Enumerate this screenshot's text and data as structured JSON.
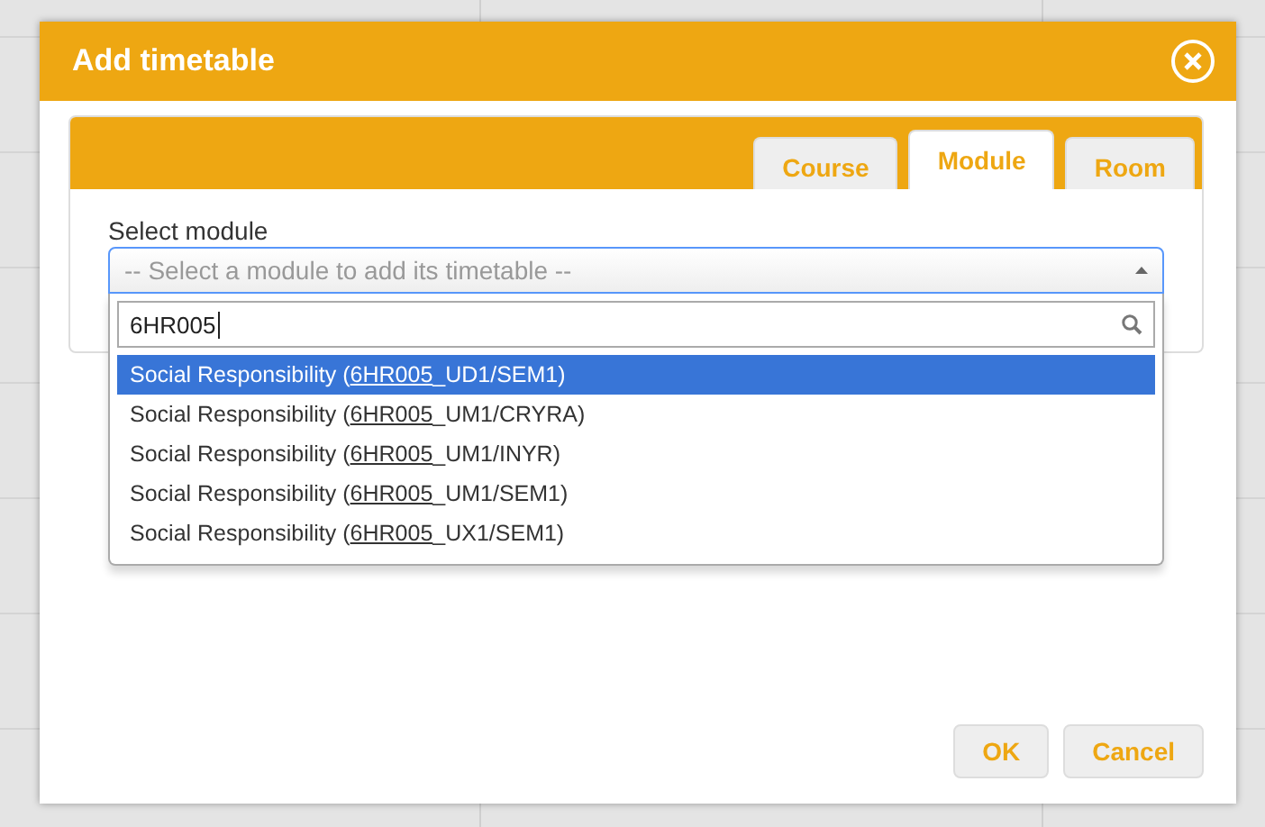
{
  "dialog": {
    "title": "Add timetable"
  },
  "tabs": [
    {
      "label": "Course",
      "selected": false
    },
    {
      "label": "Module",
      "selected": true
    },
    {
      "label": "Room",
      "selected": false
    }
  ],
  "select": {
    "label": "Select module",
    "placeholder": "-- Select a module to add its timetable --",
    "expanded": true,
    "search_value": "6HR005",
    "options": [
      {
        "before": "Social Responsibility (",
        "match": "6HR005",
        "after": "_UD1/SEM1)",
        "selected": true
      },
      {
        "before": "Social Responsibility (",
        "match": "6HR005",
        "after": "_UM1/CRYRA)",
        "selected": false
      },
      {
        "before": "Social Responsibility (",
        "match": "6HR005",
        "after": "_UM1/INYR)",
        "selected": false
      },
      {
        "before": "Social Responsibility (",
        "match": "6HR005",
        "after": "_UM1/SEM1)",
        "selected": false
      },
      {
        "before": "Social Responsibility (",
        "match": "6HR005",
        "after": "_UX1/SEM1)",
        "selected": false
      }
    ]
  },
  "buttons": [
    {
      "label": "OK"
    },
    {
      "label": "Cancel"
    }
  ]
}
